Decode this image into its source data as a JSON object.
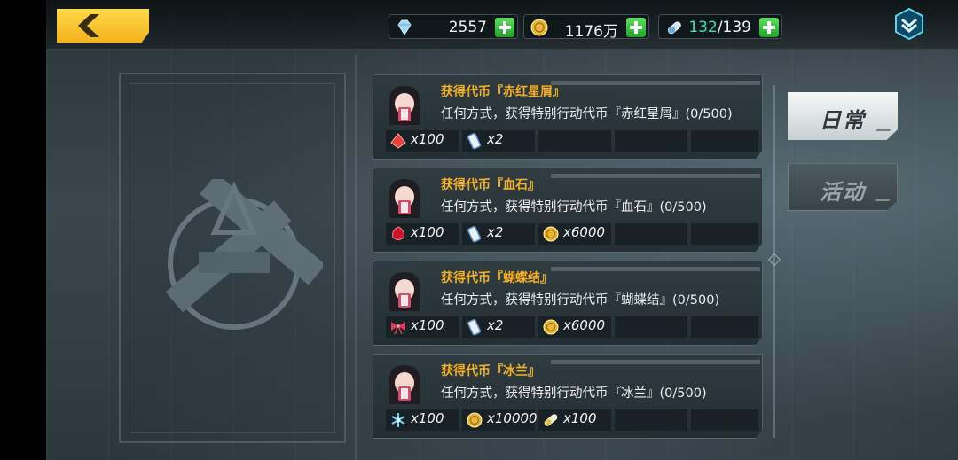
{
  "top_bar": {
    "diamonds": "2557",
    "coins": "1176万",
    "stamina_current": "132",
    "stamina_max": "/139"
  },
  "tabs": [
    {
      "label": "日常",
      "active": true
    },
    {
      "label": "活动",
      "active": false
    }
  ],
  "tasks": [
    {
      "title": "获得代币『赤红星屑』",
      "desc": "任何方式，获得特别行动代币『赤红星屑』(0/500)",
      "rewards": [
        {
          "icon": "red-crystal-icon",
          "qty": "x100"
        },
        {
          "icon": "ticket-icon",
          "qty": "x2"
        }
      ]
    },
    {
      "title": "获得代币『血石』",
      "desc": "任何方式，获得特别行动代币『血石』(0/500)",
      "rewards": [
        {
          "icon": "blood-stone-icon",
          "qty": "x100"
        },
        {
          "icon": "ticket-icon",
          "qty": "x2"
        },
        {
          "icon": "gold-coin-icon",
          "qty": "x6000"
        }
      ]
    },
    {
      "title": "获得代币『蝴蝶结』",
      "desc": "任何方式，获得特别行动代币『蝴蝶结』(0/500)",
      "rewards": [
        {
          "icon": "bow-icon",
          "qty": "x100"
        },
        {
          "icon": "ticket-icon",
          "qty": "x2"
        },
        {
          "icon": "gold-coin-icon",
          "qty": "x6000"
        }
      ]
    },
    {
      "title": "获得代币『冰兰』",
      "desc": "任何方式，获得特别行动代币『冰兰』(0/500)",
      "rewards": [
        {
          "icon": "ice-orchid-icon",
          "qty": "x100"
        },
        {
          "icon": "gold-coin-icon",
          "qty": "x10000"
        },
        {
          "icon": "exp-capsule-icon",
          "qty": "x100"
        }
      ]
    }
  ],
  "colors": {
    "accent_gold": "#f3b024",
    "plus_green": "#2fbf36",
    "stamina_green": "#3fe0b0",
    "back_button": "#f5c02a"
  }
}
